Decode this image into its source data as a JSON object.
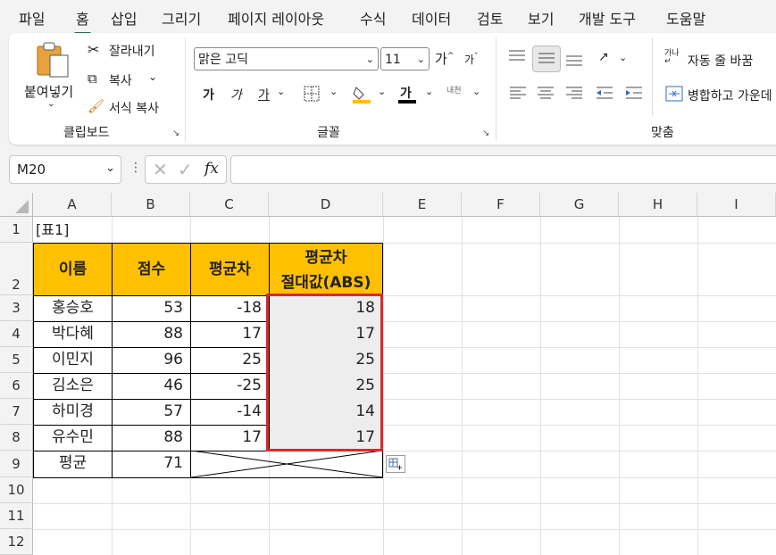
{
  "menu": {
    "tabs": [
      "파일",
      "홈",
      "삽입",
      "그리기",
      "페이지 레이아웃",
      "수식",
      "데이터",
      "검토",
      "보기",
      "개발 도구",
      "도움말"
    ],
    "active": "홈"
  },
  "ribbon": {
    "clipboard": {
      "label": "클립보드",
      "paste": "붙여넣기",
      "cut": "잘라내기",
      "copy": "복사",
      "format_painter": "서식 복사"
    },
    "font": {
      "label": "글꼴",
      "font_name": "맑은 고딕",
      "font_size": "11",
      "grow": "가",
      "shrink": "가",
      "bold": "가",
      "italic": "가",
      "underline": "가",
      "phonetic": "내천"
    },
    "alignment": {
      "label": "맞춤",
      "wrap_text": "자동 줄 바꿈",
      "merge": "병합하고 가운데"
    }
  },
  "formula_bar": {
    "name_box": "M20",
    "fx": "fx",
    "value": ""
  },
  "sheet": {
    "columns": [
      "A",
      "B",
      "C",
      "D",
      "E",
      "F",
      "G",
      "H",
      "I"
    ],
    "rows": [
      "1",
      "2",
      "3",
      "4",
      "5",
      "6",
      "7",
      "8",
      "9",
      "10",
      "11",
      "12"
    ],
    "caption": "[표1]",
    "headers": [
      "이름",
      "점수",
      "평균차",
      "평균차",
      "절대값(ABS)"
    ],
    "data": [
      [
        "홍승호",
        "53",
        "-18",
        "18"
      ],
      [
        "박다혜",
        "88",
        "17",
        "17"
      ],
      [
        "이민지",
        "96",
        "25",
        "25"
      ],
      [
        "김소은",
        "46",
        "-25",
        "25"
      ],
      [
        "하미경",
        "57",
        "-14",
        "14"
      ],
      [
        "유수민",
        "88",
        "17",
        "17"
      ]
    ],
    "average_label": "평균",
    "average_value": "71"
  },
  "colors": {
    "header_fill": "#ffc000",
    "highlight_border": "#e0262e",
    "accent": "#217346"
  }
}
